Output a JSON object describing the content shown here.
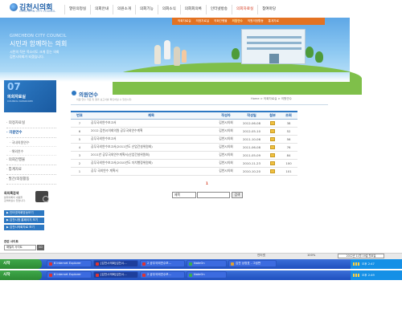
{
  "header": {
    "logo_title": "김천시의회",
    "logo_sub": "GIMCHEON CITY COUNCIL",
    "nav": [
      "열린의정실",
      "의회안내",
      "의원소개",
      "의회기능",
      "의회소식",
      "의회회의록",
      "인터넷방송",
      "의회자료실",
      "참여마당"
    ],
    "nav_active_index": 7,
    "subnav": [
      "의회자료실",
      "의정자료실",
      "의회간행물",
      "의원연수",
      "의원의정활동",
      "통계자료"
    ],
    "subnav_active_index": 3
  },
  "banner": {
    "eng": "GIMCHEON CITY COUNCIL",
    "slogan": "시민과 함께하는 의회",
    "desc1": "시민의 작은 목소리도 크게 듣는 의회",
    "desc2": "김천시의회가 되겠습니다."
  },
  "sidebar": {
    "number": "07",
    "title": "의회자료실",
    "title_en": "COUNCIL DATAROOM",
    "items": [
      {
        "label": "· 의정자료실",
        "type": "item",
        "active": false
      },
      {
        "label": "· 의원연수",
        "type": "item",
        "active": true
      },
      {
        "label": "· 국내의원연수",
        "type": "sub",
        "active": false
      },
      {
        "label": "· 해외연수",
        "type": "sub",
        "active": false
      },
      {
        "label": "· 의회간행물",
        "type": "item",
        "active": false
      },
      {
        "label": "· 통계자료",
        "type": "item",
        "active": false
      },
      {
        "label": "· 발간/의정활동",
        "type": "item",
        "active": false
      }
    ],
    "box_title": "회의록검색",
    "box_line1": "본회의록의 내용을",
    "box_line2": "검색하실수 있습니다.",
    "buttons": [
      "▶ 인터넷의회방송보기",
      "▶ 김천시청 홈페이지 보기",
      "▶ 김천시의회자료 보기"
    ],
    "family_label": "관련 사이트",
    "family_select": "패밀리 사이트",
    "family_go": "GO"
  },
  "content": {
    "title": "의원연수",
    "subtitle": "의원 연수 자료 및 결과 보고서를 확인하실 수 있습니다.",
    "breadcrumb": "Home > 의회자료실 > 의원연수",
    "columns": [
      "번호",
      "제목",
      "작성자",
      "작성일",
      "첨부",
      "조회"
    ],
    "rows": [
      {
        "no": "7",
        "title": "공무국외연수보고서",
        "author": "김천시의회",
        "date": "2012-06-08",
        "views": "38"
      },
      {
        "no": "6",
        "title": "2012 김천시의회의원 공무국외연수계획",
        "author": "김천시의회",
        "date": "2012-05-10",
        "views": "52"
      },
      {
        "no": "5",
        "title": "공무국외연수보고서",
        "author": "김천시의회",
        "date": "2011-10-06",
        "views": "56"
      },
      {
        "no": "4",
        "title": "공무국외연수보고서(2011년도 산업건설위원회)",
        "author": "김천시의회",
        "date": "2011-06-08",
        "views": "76"
      },
      {
        "no": "3",
        "title": "2011년 공무국외연수계획서(산업건설위원회)",
        "author": "김천시의회",
        "date": "2011-05-09",
        "views": "84"
      },
      {
        "no": "2",
        "title": "공무국외연수보고서(2010년도 자치행정위원회)",
        "author": "김천시의회",
        "date": "2010-11-23",
        "views": "100"
      },
      {
        "no": "1",
        "title": "공무 국외연수 계획서",
        "author": "김천시의회",
        "date": "2010-10-20",
        "views": "101"
      }
    ],
    "page": "1",
    "search_field": "제목",
    "search_value": "",
    "search_button": "검색"
  },
  "statusbar": {
    "zone": "인터넷",
    "zoom": "100%",
    "date": "2012년 11월 19일 월요일"
  },
  "taskbar1": {
    "start": "시작",
    "tasks": [
      "6 Internet Explorer",
      "[김천시의회]김천시...",
      "2 공무국외연수보...",
      "NateOn",
      "김천 상정표 - 그림판"
    ],
    "active_index": 1,
    "clock": "오후 2:47"
  },
  "taskbar2": {
    "start": "시작",
    "tasks": [
      "6 Internet Explorer",
      "[김천시의회]김천시...",
      "2 공무국외연수보...",
      "NateOn"
    ],
    "active_index": 1,
    "clock": "오후 2:49"
  }
}
